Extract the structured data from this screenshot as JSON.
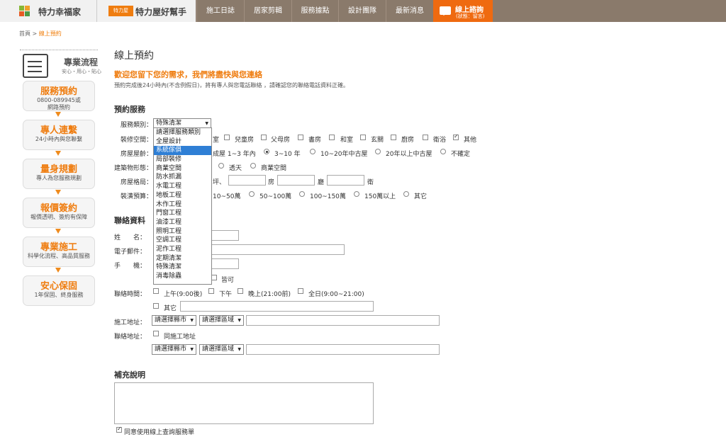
{
  "brand": {
    "site1": "特力幸福家",
    "logo2": "特力屋",
    "site2": "特力屋好幫手"
  },
  "nav": [
    "施工日誌",
    "居家剪輯",
    "服務據點",
    "設計團隊",
    "最新消息"
  ],
  "chat": {
    "title": "線上諮詢",
    "sub": "(狀態：留言)"
  },
  "breadcrumb": {
    "home": "首頁",
    "sep": ">",
    "current": "線上預約"
  },
  "sidebar": {
    "title": "專業流程",
    "sub": "安心・用心・貼心",
    "steps": [
      {
        "title": "服務預約",
        "desc1": "0800-089945或",
        "desc2": "網路預約"
      },
      {
        "title": "專人連繫",
        "desc1": "24小時內與您聯繫",
        "desc2": ""
      },
      {
        "title": "量身規劃",
        "desc1": "專人為您服務規劃",
        "desc2": ""
      },
      {
        "title": "報價簽約",
        "desc1": "報價透明、簽約有保障",
        "desc2": ""
      },
      {
        "title": "專業施工",
        "desc1": "科學化流程、高品質服務",
        "desc2": ""
      },
      {
        "title": "安心保固",
        "desc1": "1年保固、終身服務",
        "desc2": ""
      }
    ]
  },
  "page": {
    "title": "線上預約",
    "welcome": "歡迎您留下您的需求，我們將盡快與您連絡",
    "note": "預約完成後24小時內(不含例假日)，將有專人與您電話聯絡 ，請確認您的聯絡電話資料正確。"
  },
  "service": {
    "section": "預約服務",
    "type_label": "服務類別：",
    "type_value": "特殊清潔",
    "options": [
      "請選擇服務類別",
      "全屋設計",
      "系統傢俱",
      "局部裝修",
      "商業空間",
      "防水抓漏",
      "水電工程",
      "地板工程",
      "木作工程",
      "門窗工程",
      "油漆工程",
      "照明工程",
      "空調工程",
      "泥作工程",
      "定期清潔",
      "特殊清潔",
      "消毒除蟲"
    ],
    "space_label": "裝修空間：",
    "spaces": [
      "室",
      "兒童房",
      "父母房",
      "書房",
      "和室",
      "玄關",
      "廚房",
      "衛浴",
      "其他"
    ],
    "age_label": "房屋屋齡：",
    "ages": [
      "成屋 1~3 年內",
      "3~10 年",
      "10~20年中古屋",
      "20年以上中古屋",
      "不確定"
    ],
    "building_label": "建築物形態：",
    "buildings": [
      "透天",
      "商業空間"
    ],
    "layout_label": "房屋格局：",
    "layout_units": [
      "坪、",
      "房",
      "廳",
      "衛"
    ],
    "budget_label": "裝潢預算：",
    "budgets": [
      "10~50萬",
      "50~100萬",
      "100~150萬",
      "150萬以上",
      "其它"
    ]
  },
  "contact": {
    "section": "聯絡資料",
    "name_label": "姓　　名：",
    "email_label": "電子郵件：",
    "phone_label": "手　　機：",
    "any": "皆可",
    "time_label": "聯絡時間：",
    "times": [
      "上午(9:00後)",
      "下午",
      "晚上(21:00前)",
      "全日(9:00~21:00)"
    ],
    "other": "其它",
    "site_label": "施工地址：",
    "city": "請選擇縣市",
    "district": "請選擇區域",
    "mail_label": "聯絡地址：",
    "same": "同施工地址"
  },
  "extra": {
    "section": "補充說明",
    "agree": "同意使用線上查詢服務單"
  }
}
